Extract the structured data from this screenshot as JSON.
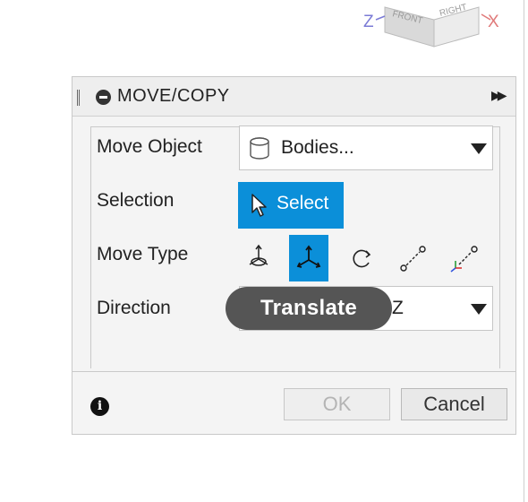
{
  "viewcube": {
    "face_left": "FRONT",
    "face_right": "RIGHT",
    "axis_z": "Z",
    "axis_x": "X"
  },
  "dialog": {
    "title": "MOVE/COPY",
    "rows": {
      "move_object": {
        "label": "Move Object",
        "value": "Bodies..."
      },
      "selection": {
        "label": "Selection",
        "button": "Select"
      },
      "move_type": {
        "label": "Move Type",
        "options": [
          "free-move-icon",
          "translate-icon",
          "rotate-icon",
          "point-to-point-icon",
          "point-to-position-icon"
        ],
        "selected": "translate-icon"
      },
      "direction": {
        "label": "Direction",
        "value": "Z"
      }
    },
    "buttons": {
      "ok": "OK",
      "cancel": "Cancel"
    }
  },
  "tooltip": {
    "text": "Translate"
  },
  "colors": {
    "accent": "#0b8fd9",
    "tooltip_bg": "#555555"
  }
}
